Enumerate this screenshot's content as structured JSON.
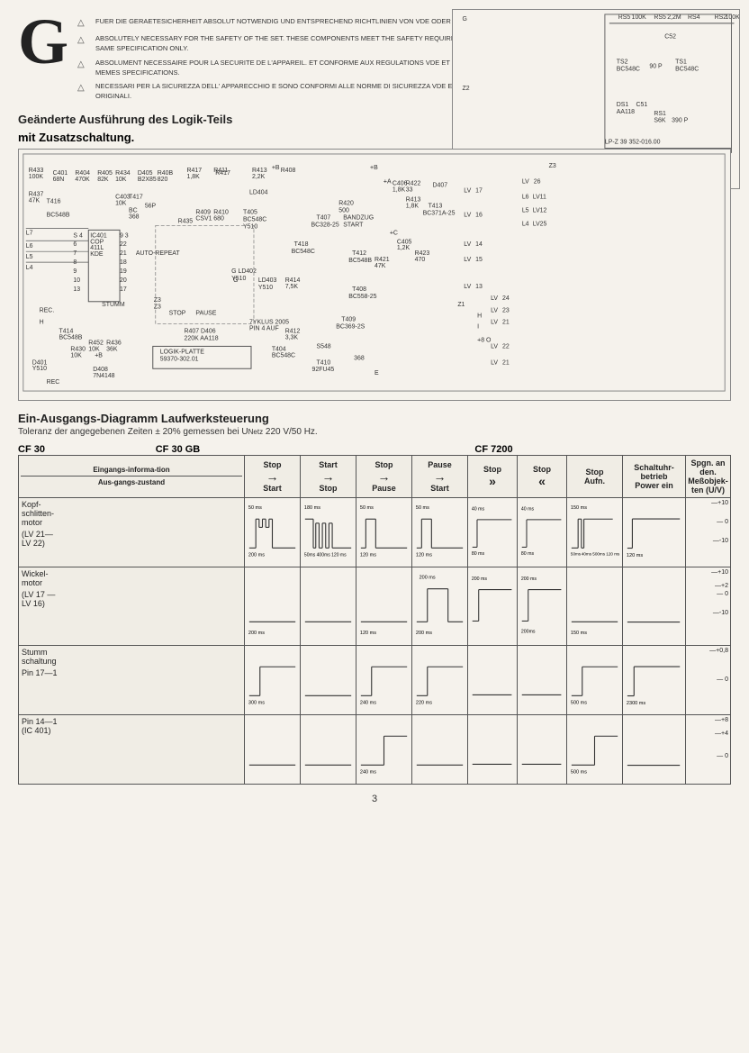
{
  "logo": "G",
  "safety_notes": [
    "FUER DIE GERAETESICHERHEIT ABSOLUT NOTWENDIG UND ENTSPRECHEND RICHTLINIEN VON VDE ODER IEC. DIESE BAUTEILE NUR MIT GLEICHER SPEZIFIKATION VERWENDEN WERDEN.",
    "ABSOLUTELY NECESSARY FOR THE SAFETY OF THE SET. THESE COMPONENTS MEET THE SAFETY REQUIREMENTS ACCORDING TO VDE OR IEC, RESP., AND MUST BE REPLACED BY PARTS OF SAME SPECIFICATION ONLY.",
    "ABSOLUMENT NECESSAIRE POUR LA SECURITE DE L'APPAREIL. ET CONFORME AUX REGULATIONS VDE ET IEC. EN CAS DE REMPLACEMENT, N'UTILISER QUE DES COMPOSANTS AVEC LES MEMES SPECIFICATIONS.",
    "NECESSARI PER LA SICUREZZA DELL' APPARECCHIO E SONO CONFORMI ALLE NORME DI SICUREZZA VDE E IEC. IN CASA DI SOSTITUZIONE, IMPIEGARE QUINDI SOLTANTO PEZZI IN RICAMBIO ORIGINALI."
  ],
  "changed_section_title": "Geänderte Ausführung des Logik-Teils",
  "changed_section_subtitle": "mit Zusatzschaltung.",
  "diagram_section_title": "Ein-Ausgangs-Diagramm Laufwerksteuerung",
  "diagram_subtitle": "Toleranz der angegebenen Zeiten ± 20% gemessen bei U",
  "diagram_subtitle_sub": "Netz",
  "diagram_subtitle_end": " 220 V/50 Hz.",
  "models": {
    "cf30": "CF 30",
    "cf30gb": "CF 30 GB",
    "cf7200": "CF 7200"
  },
  "table": {
    "header": {
      "eingangs_label": "Eingangs-informa-tion",
      "aus_label": "Aus-gangs-zustand",
      "col1_top": "Stop",
      "col1_arr": "→",
      "col1_bot": "Start",
      "col2_top": "Start",
      "col2_arr": "→",
      "col2_bot": "Stop",
      "col3_top": "Stop",
      "col3_arr": "→",
      "col3_bot": "Pause",
      "col4_top": "Pause",
      "col4_arr": "→",
      "col4_bot": "Start",
      "col5_top": "Stop",
      "col5_arr": "»",
      "col5_bot": "",
      "col6_top": "Stop",
      "col6_arr": "«",
      "col6_bot": "",
      "col7_top": "Stop",
      "col7_arr": "",
      "col7_bot": "Aufn.",
      "schaltuhr_label": "Schaltuhr-betrieb",
      "schaltuhr_sub": "Power ein",
      "spgn_label": "Spgn. an den. Meßobjek-ten (U/V)"
    },
    "rows": [
      {
        "label": "Kopf-schlitten-motor",
        "sublabel": "(LV 21—\nLV 22)",
        "cells": [
          {
            "timings": [
              "50 ms",
              "200 ms"
            ],
            "shape": "pulse_group"
          },
          {
            "timings": [
              "180 ms",
              "50 ms 400ms 120 ms"
            ],
            "shape": "pulse_group2"
          },
          {
            "timings": [
              "50 ms",
              "120 ms"
            ],
            "shape": "pulse_single"
          },
          {
            "timings": [
              "50 ms",
              "120 ms"
            ],
            "shape": "pulse_single"
          },
          {
            "timings": [
              "40 ms",
              "80 ms"
            ],
            "shape": "pulse_up"
          },
          {
            "timings": [
              "40 ms",
              "80 ms"
            ],
            "shape": "pulse_up"
          },
          {
            "timings": [
              "150 ms",
              "50 ms",
              "40 ms 500ms 120 ms"
            ],
            "shape": "pulse_complex"
          },
          {}
        ],
        "voltage_pos": "+10",
        "voltage_zero": "0",
        "voltage_neg": "-10"
      },
      {
        "label": "Wickel-motor",
        "sublabel": "(LV 17—\nLV 16)",
        "cells": [
          {
            "timings": [
              "200 ms"
            ],
            "shape": "flat"
          },
          {},
          {
            "timings": [
              "120 ms"
            ],
            "shape": "flat"
          },
          {
            "timings": [
              "200 ms",
              "200 ms"
            ],
            "shape": "pulse_up_wide"
          },
          {
            "timings": [
              "200 ms"
            ],
            "shape": "flat"
          },
          {
            "timings": [
              "200 ms"
            ],
            "shape": "flat"
          },
          {
            "timings": [
              "150 ms"
            ],
            "shape": "flat"
          },
          {}
        ],
        "voltage_pos": "+10",
        "voltage_mid": "+2",
        "voltage_zero": "0",
        "voltage_neg": "-10"
      },
      {
        "label": "Stumm schaltung",
        "sublabel": "Pin 17—1",
        "cells": [
          {
            "timings": [
              "300 ms"
            ],
            "shape": "step_up"
          },
          {},
          {
            "timings": [
              "240 ms"
            ],
            "shape": "step_up"
          },
          {
            "timings": [
              "220 ms"
            ],
            "shape": "step_up"
          },
          {},
          {},
          {
            "timings": [
              "500 ms"
            ],
            "shape": "step_up"
          },
          {
            "timings": [
              "2300 ms"
            ],
            "shape": "step_wide"
          }
        ],
        "voltage_pos": "+0,8",
        "voltage_zero": "0"
      },
      {
        "label": "Pin 14—1",
        "sublabel": "(IC 401)",
        "cells": [
          {},
          {},
          {
            "timings": [
              "240 ms"
            ],
            "shape": "step_up_late"
          },
          {},
          {},
          {},
          {
            "timings": [
              "500 ms"
            ],
            "shape": "step_up_late"
          },
          {}
        ],
        "voltage_pos": "+8",
        "voltage_mid": "+4",
        "voltage_zero": "0"
      }
    ]
  },
  "page_number": "3"
}
